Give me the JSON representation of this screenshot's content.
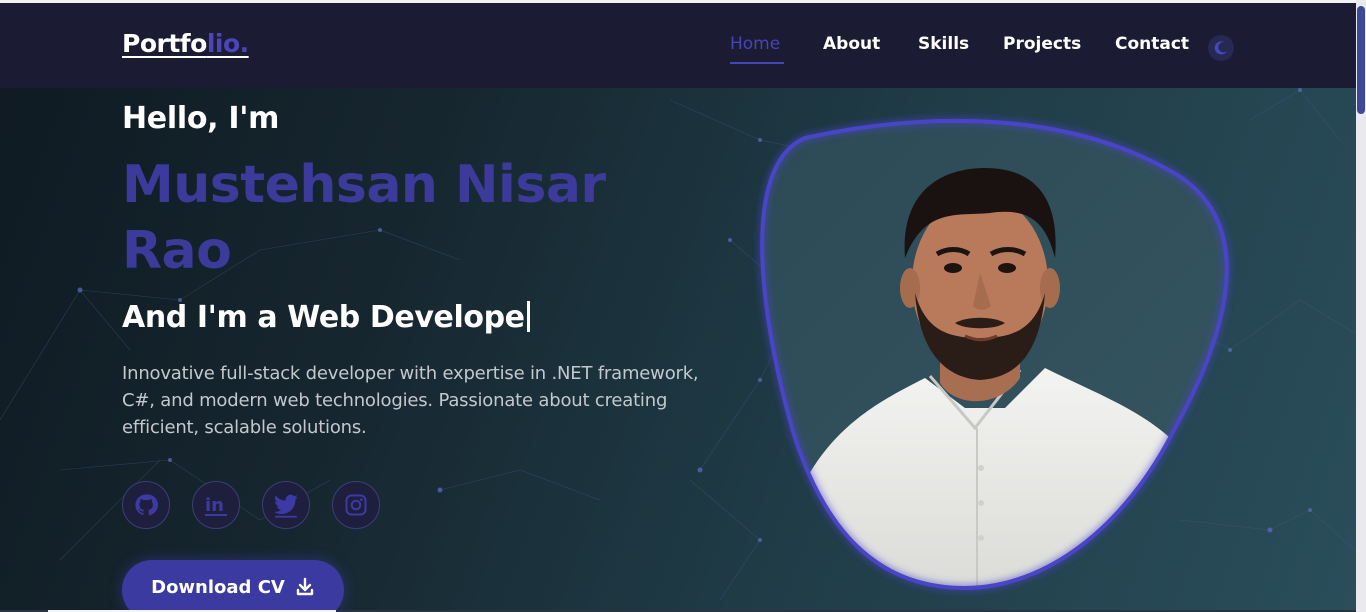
{
  "header": {
    "logo_main": "Portfo",
    "logo_accent": "lio.",
    "nav": [
      {
        "label": "Home",
        "active": true
      },
      {
        "label": "About",
        "active": false
      },
      {
        "label": "Skills",
        "active": false
      },
      {
        "label": "Projects",
        "active": false
      },
      {
        "label": "Contact",
        "active": false
      }
    ],
    "theme_icon": "moon-icon"
  },
  "hero": {
    "greeting": "Hello, I'm",
    "name": "Mustehsan Nisar Rao",
    "role": "And I'm a Web Develope",
    "description": "Innovative full-stack developer with expertise in .NET framework, C#, and modern web technologies. Passionate about creating efficient, scalable solutions.",
    "socials": [
      "github-icon",
      "linkedin-icon",
      "twitter-icon",
      "instagram-icon"
    ],
    "cv_button": "Download CV",
    "cv_icon": "download-icon",
    "photo_icon": "profile-photo"
  },
  "colors": {
    "accent": "#3c3a9a",
    "header_bg": "#1b1c33",
    "text": "#ffffff",
    "muted_text": "#c3c8cd"
  }
}
